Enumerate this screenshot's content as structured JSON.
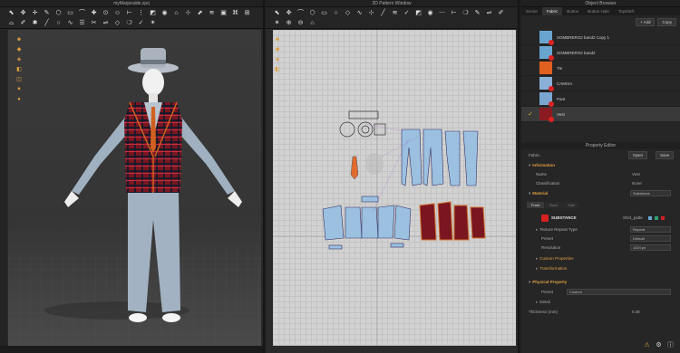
{
  "windows": {
    "avatar_title": "myMarjoraide.zprj",
    "pattern_title": "2D Pattern Window",
    "browser_title": "Object Browser",
    "property_title": "Property Editor"
  },
  "object_browser": {
    "tabs": [
      "Scene",
      "Fabric",
      "Button",
      "Button Hole",
      "Topstitch"
    ],
    "active_tab": "Fabric",
    "add_label": "+ Add",
    "copy_label": "Copy",
    "fabrics": [
      {
        "name": "SOMBRERO2 band2 Copy 1",
        "color": "#6aa5d0",
        "logo": true,
        "selected": false
      },
      {
        "name": "SOMBRERO2 band2",
        "color": "#6aa5d0",
        "logo": true,
        "selected": false
      },
      {
        "name": "Tie",
        "color": "#e06020",
        "logo": false,
        "selected": false
      },
      {
        "name": "CAMISA",
        "color": "#8ab0d8",
        "logo": true,
        "selected": false
      },
      {
        "name": "Pant",
        "color": "#7aa6d0",
        "logo": true,
        "selected": false
      },
      {
        "name": "Vest",
        "color": "#8a1a22",
        "logo": true,
        "selected": true
      }
    ]
  },
  "property_editor": {
    "fabric_label": "Fabric",
    "open_label": "Open",
    "save_label": "Save",
    "information": "Information",
    "name_label": "Name",
    "name_value": "Vest",
    "classification_label": "Classification",
    "classification_value": "None",
    "material_label": "Material",
    "material_value": "Substance",
    "subtabs": [
      "Front",
      "Back",
      "Side"
    ],
    "substance_label": "SUBSTANCE",
    "substance_file": "Shirt_patte",
    "texture_repeat_label": "Texture Repeat Type",
    "texture_repeat_value": "Repeat",
    "preset_label": "Preset",
    "preset_value": "Default",
    "resolution_label": "Resolution",
    "resolution_value": "1024 px",
    "custom_properties": "Custom Properties",
    "transformation": "Transformation",
    "physical_property": "Physical Property",
    "physical_preset_label": "Preset",
    "physical_preset_value": "Custom",
    "detail_label": "Detail",
    "thickness_label": "Thickness (mm)",
    "thickness_value": "0.38"
  },
  "colors": {
    "accent": "#e0a040",
    "vest": "#8a1a22",
    "pattern_blue": "#9cc0e0"
  }
}
